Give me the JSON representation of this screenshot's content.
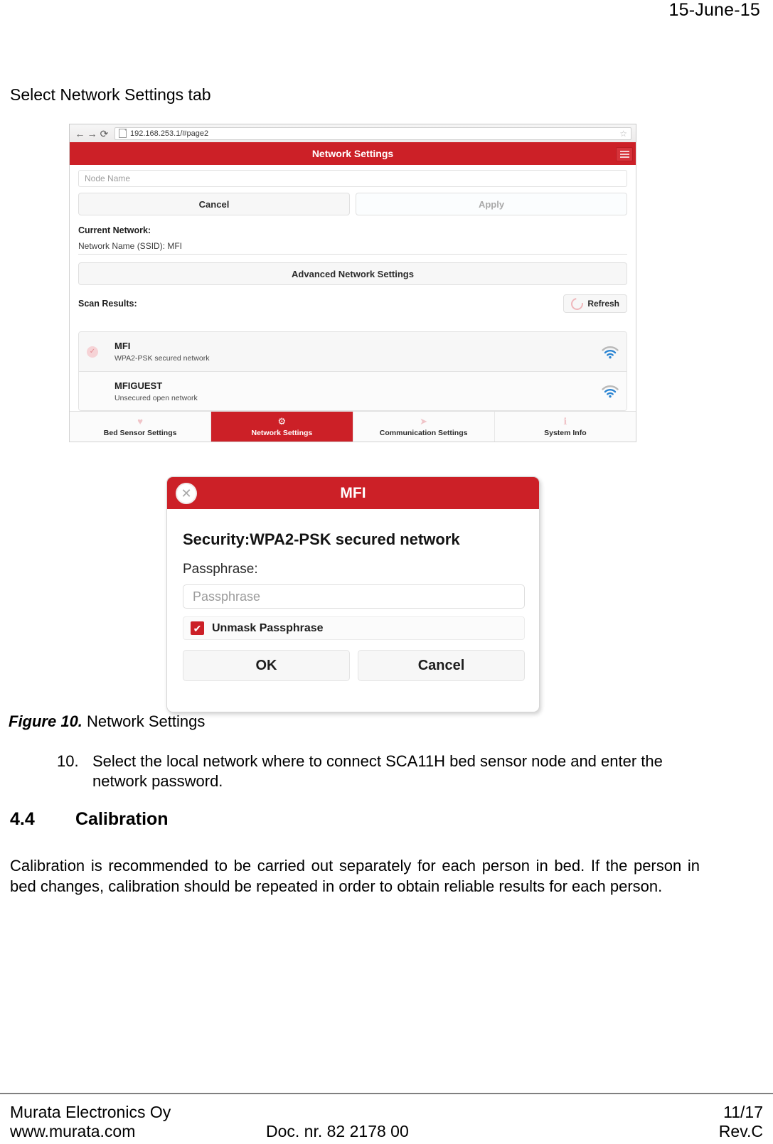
{
  "page": {
    "date": "15-June-15",
    "intro_line": "Select Network Settings tab"
  },
  "browser": {
    "back_icon": "←",
    "forward_icon": "→",
    "reload_icon": "⟳",
    "url": "192.168.253.1/#page2",
    "star_icon": "☆"
  },
  "app": {
    "header_title": "Network Settings",
    "node_name_placeholder": "Node Name",
    "cancel_label": "Cancel",
    "apply_label": "Apply",
    "current_network_label": "Current Network:",
    "ssid_line": "Network Name (SSID): MFI",
    "advanced_label": "Advanced Network Settings",
    "scan_results_label": "Scan Results:",
    "refresh_label": "Refresh",
    "networks": [
      {
        "name": "MFI",
        "security": "WPA2-PSK secured network",
        "connected": true,
        "check_icon": "✓"
      },
      {
        "name": "MFIGUEST",
        "security": "Unsecured open network",
        "connected": false,
        "check_icon": ""
      }
    ],
    "tabs": [
      {
        "label": "Bed Sensor Settings",
        "icon": "♥",
        "icon_name": "heart-icon",
        "active": false
      },
      {
        "label": "Network Settings",
        "icon": "⚙",
        "icon_name": "gear-icon",
        "active": true
      },
      {
        "label": "Communication Settings",
        "icon": "➤",
        "icon_name": "send-icon",
        "active": false
      },
      {
        "label": "System Info",
        "icon": "ℹ",
        "icon_name": "info-icon",
        "active": false
      }
    ],
    "accent_color": "#cc2027"
  },
  "dialog": {
    "title": "MFI",
    "close_icon": "✕",
    "security_text": "Security:WPA2-PSK secured network",
    "passphrase_label": "Passphrase:",
    "passphrase_placeholder": "Passphrase",
    "unmask_label": "Unmask Passphrase",
    "unmask_checked_icon": "✔",
    "ok_label": "OK",
    "cancel_label": "Cancel"
  },
  "figure": {
    "number": "Figure 10.",
    "caption": "Network Settings"
  },
  "list_item": {
    "number": "10.",
    "text": "Select the local network where to connect SCA11H bed sensor node and enter the network password."
  },
  "section": {
    "number": "4.4",
    "title": "Calibration",
    "paragraph": "Calibration is recommended to be carried out separately for each person in bed. If the person in bed changes, calibration should be repeated in order to obtain reliable results for each person."
  },
  "footer": {
    "company": "Murata Electronics Oy",
    "website": "www.murata.com",
    "doc_number": "Doc. nr. 82 2178 00",
    "page_number": "11/17",
    "revision": "Rev.C"
  }
}
